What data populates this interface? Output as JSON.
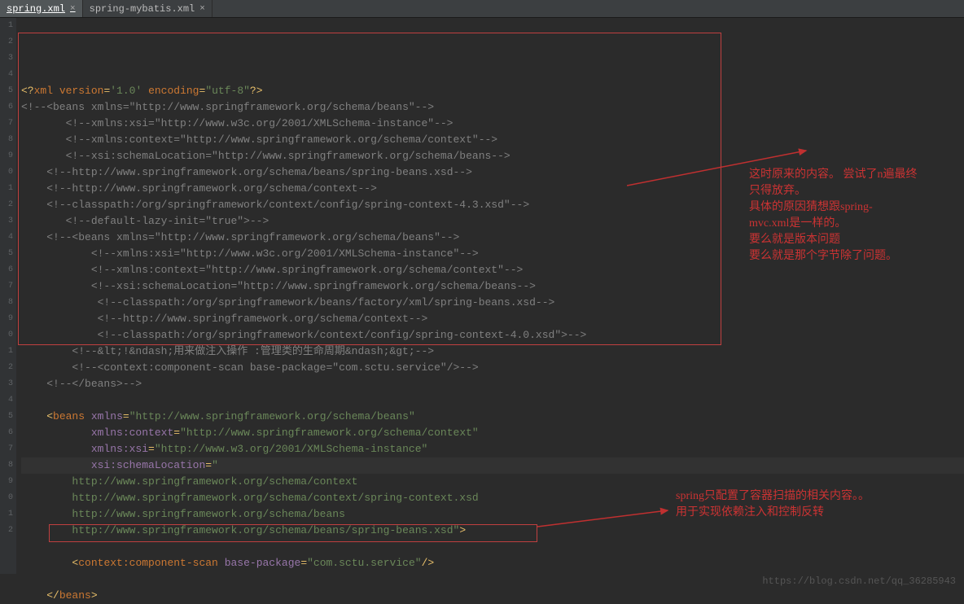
{
  "tabs": [
    {
      "label": "spring.xml",
      "active": true
    },
    {
      "label": "spring-mybatis.xml",
      "active": false
    }
  ],
  "code_lines": [
    {
      "n": "1",
      "html": "<span class='tag-bracket'>&lt;?</span><span class='keyword'>xml version</span><span class='tag-bracket'>=</span><span class='string'>'1.0'</span> <span class='keyword'>encoding</span><span class='tag-bracket'>=</span><span class='string'>\"utf-8\"</span><span class='tag-bracket'>?&gt;</span>"
    },
    {
      "n": "2",
      "html": "<span class='comment'>&lt;!--&lt;beans xmlns=\"http://www.springframework.org/schema/beans\"--&gt;</span>"
    },
    {
      "n": "3",
      "html": "       <span class='comment'>&lt;!--xmlns:xsi=\"http://www.w3c.org/2001/XMLSchema-instance\"--&gt;</span>"
    },
    {
      "n": "4",
      "html": "       <span class='comment'>&lt;!--xmlns:context=\"http://www.springframework.org/schema/context\"--&gt;</span>"
    },
    {
      "n": "5",
      "html": "       <span class='comment'>&lt;!--xsi:schemaLocation=\"http://www.springframework.org/schema/beans--&gt;</span>"
    },
    {
      "n": "6",
      "html": "    <span class='comment'>&lt;!--http://www.springframework.org/schema/beans/spring-beans.xsd--&gt;</span>"
    },
    {
      "n": "7",
      "html": "    <span class='comment'>&lt;!--http://www.springframework.org/schema/context--&gt;</span>"
    },
    {
      "n": "8",
      "html": "    <span class='comment'>&lt;!--classpath:/org/springframework/context/config/spring-context-4.3.xsd\"--&gt;</span>"
    },
    {
      "n": "9",
      "html": "       <span class='comment'>&lt;!--default-lazy-init=\"true\"&gt;--&gt;</span>"
    },
    {
      "n": "0",
      "html": "    <span class='comment'>&lt;!--&lt;beans xmlns=\"http://www.springframework.org/schema/beans\"--&gt;</span>"
    },
    {
      "n": "1",
      "html": "           <span class='comment'>&lt;!--xmlns:xsi=\"http://www.w3c.org/2001/XMLSchema-instance\"--&gt;</span>"
    },
    {
      "n": "2",
      "html": "           <span class='comment'>&lt;!--xmlns:context=\"http://www.springframework.org/schema/context\"--&gt;</span>"
    },
    {
      "n": "3",
      "html": "           <span class='comment'>&lt;!--xsi:schemaLocation=\"http://www.springframework.org/schema/beans--&gt;</span>"
    },
    {
      "n": "4",
      "html": "            <span class='comment'>&lt;!--classpath:/org/springframework/beans/factory/xml/spring-beans.xsd--&gt;</span>"
    },
    {
      "n": "5",
      "html": "            <span class='comment'>&lt;!--http://www.springframework.org/schema/context--&gt;</span>"
    },
    {
      "n": "6",
      "html": "            <span class='comment'>&lt;!--classpath:/org/springframework/context/config/spring-context-4.0.xsd\"&gt;--&gt;</span>"
    },
    {
      "n": "7",
      "html": "        <span class='comment'>&lt;!--&amp;lt;!&amp;ndash;用来做注入操作 :管理类的生命周期&amp;ndash;&amp;gt;--&gt;</span>"
    },
    {
      "n": "8",
      "html": "        <span class='comment'>&lt;!--&lt;context:component-scan base-package=\"com.sctu.service\"/&gt;--&gt;</span>"
    },
    {
      "n": "9",
      "html": "    <span class='comment'>&lt;!--&lt;/beans&gt;--&gt;</span>"
    },
    {
      "n": "0",
      "html": ""
    },
    {
      "n": "1",
      "html": "    <span class='tag-bracket'>&lt;</span><span class='keyword'>beans</span> <span class='attr-name'>xmlns</span><span class='tag-bracket'>=</span><span class='string'>\"http://www.springframework.org/schema/beans\"</span>"
    },
    {
      "n": "2",
      "html": "           <span class='attr-name'>xmlns:context</span><span class='tag-bracket'>=</span><span class='string'>\"http://www.springframework.org/schema/context\"</span>"
    },
    {
      "n": "3",
      "html": "           <span class='attr-name'>xmlns:xsi</span><span class='tag-bracket'>=</span><span class='string'>\"http://www.w3.org/2001/XMLSchema-instance\"</span>"
    },
    {
      "n": "4",
      "html": "           <span class='attr-name'>xsi:schemaLocation</span><span class='tag-bracket'>=</span><span class='string'>\"</span>",
      "hl": true
    },
    {
      "n": "5",
      "html": "        <span class='string'>http://www.springframework.org/schema/context</span>"
    },
    {
      "n": "6",
      "html": "        <span class='string'>http://www.springframework.org/schema/context/spring-context.xsd</span>"
    },
    {
      "n": "7",
      "html": "        <span class='string'>http://www.springframework.org/schema/beans</span>"
    },
    {
      "n": "8",
      "html": "        <span class='string'>http://www.springframework.org/schema/beans/spring-beans.xsd\"</span><span class='tag-bracket'>&gt;</span>"
    },
    {
      "n": "9",
      "html": ""
    },
    {
      "n": "0",
      "html": "        <span class='tag-bracket'>&lt;</span><span class='keyword'>context:component-scan</span> <span class='attr-name'>base-package</span><span class='tag-bracket'>=</span><span class='string'>\"com.sctu.service\"</span><span class='tag-bracket'>/&gt;</span>"
    },
    {
      "n": "1",
      "html": ""
    },
    {
      "n": "2",
      "html": "    <span class='tag-bracket'>&lt;/</span><span class='keyword'>beans</span><span class='tag-bracket'>&gt;</span>"
    }
  ],
  "annotations": {
    "top": "这时原来的内容。  尝试了n遍最终\n只得放弃。\n    具体的原因猜想跟spring-\nmvc.xml是一样的。\n    要么就是版本问题\n    要么就是那个字节除了问题。",
    "bottom": "spring只配置了容器扫描的相关内容。。\n    用于实现依赖注入和控制反转"
  },
  "watermark": "https://blog.csdn.net/qq_36285943"
}
